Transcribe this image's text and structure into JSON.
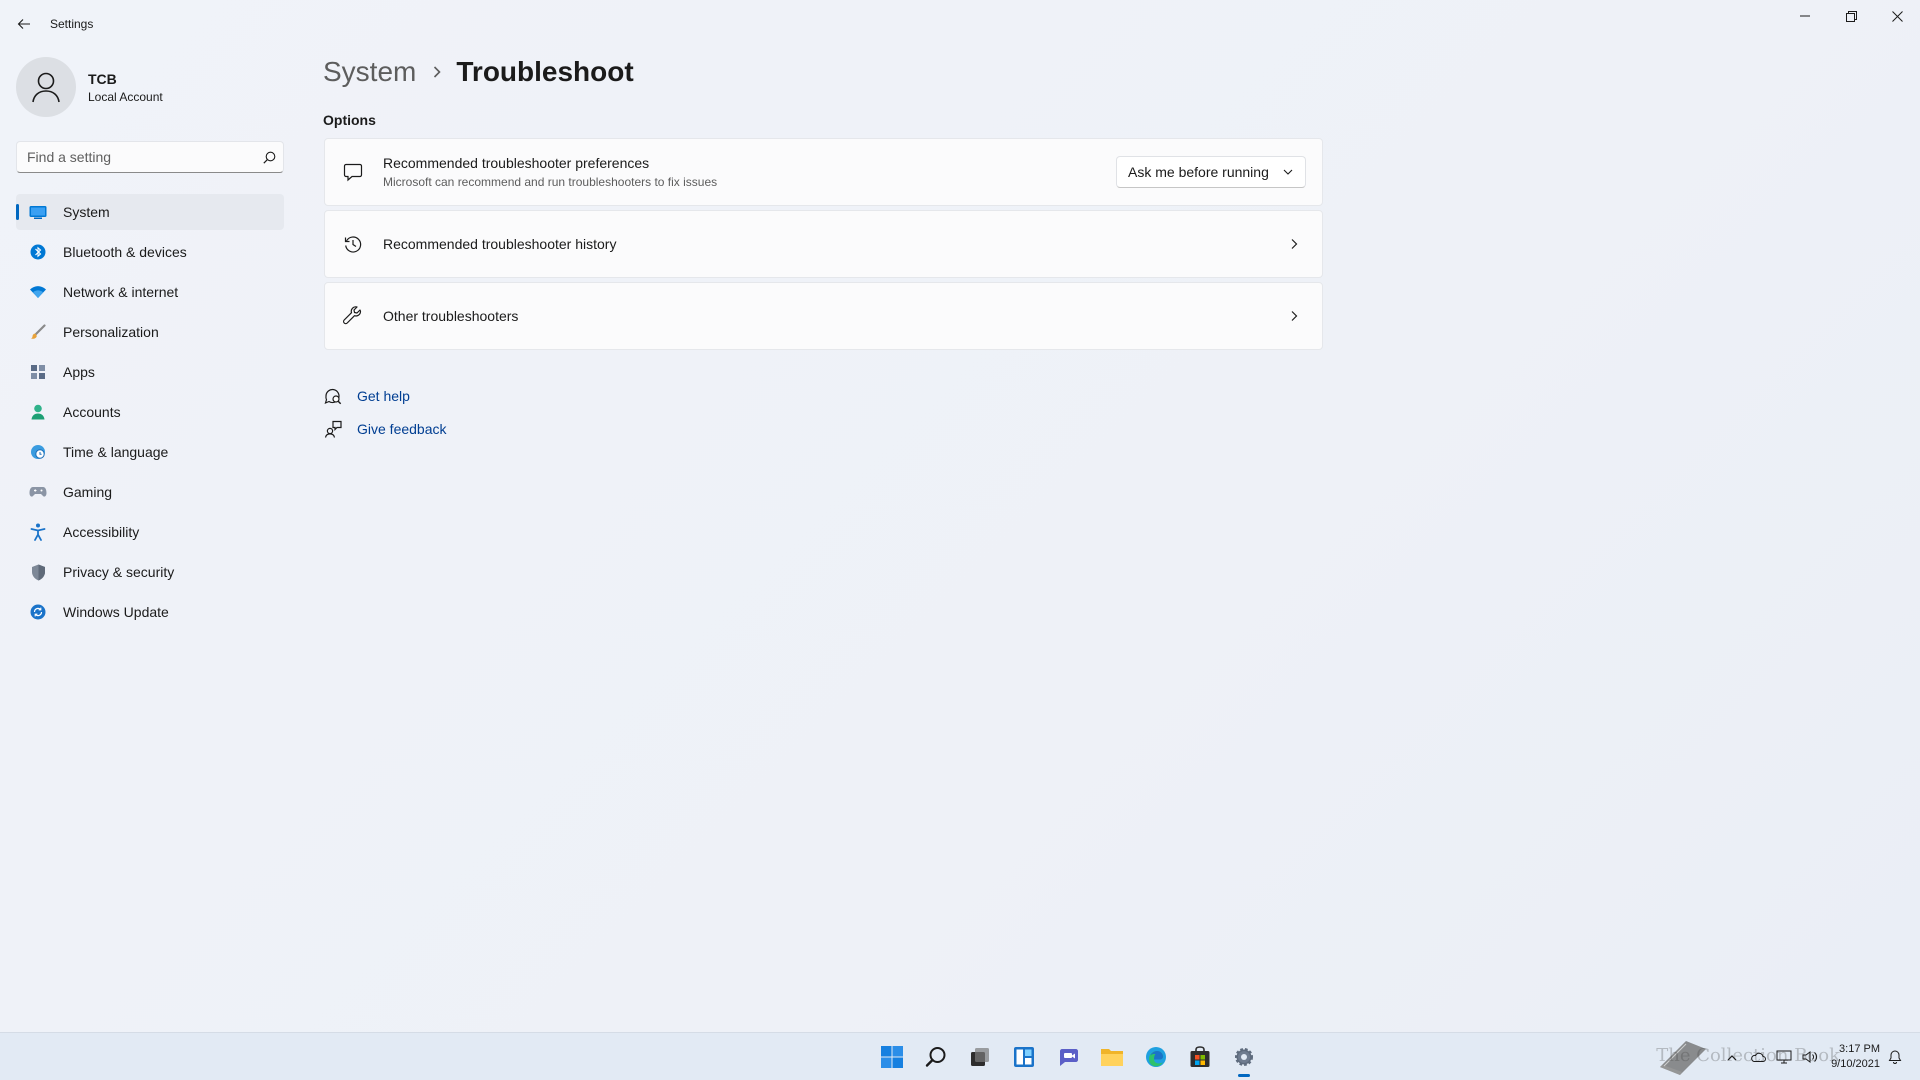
{
  "window": {
    "title": "Settings",
    "controls": [
      "minimize",
      "restore",
      "close"
    ]
  },
  "profile": {
    "name": "TCB",
    "account_type": "Local Account"
  },
  "search": {
    "placeholder": "Find a setting",
    "value": ""
  },
  "sidebar": {
    "items": [
      {
        "label": "System",
        "icon": "system-monitor-icon",
        "active": true
      },
      {
        "label": "Bluetooth & devices",
        "icon": "bluetooth-icon"
      },
      {
        "label": "Network & internet",
        "icon": "wifi-icon"
      },
      {
        "label": "Personalization",
        "icon": "brush-icon"
      },
      {
        "label": "Apps",
        "icon": "apps-icon"
      },
      {
        "label": "Accounts",
        "icon": "person-icon"
      },
      {
        "label": "Time & language",
        "icon": "globe-clock-icon"
      },
      {
        "label": "Gaming",
        "icon": "gamepad-icon"
      },
      {
        "label": "Accessibility",
        "icon": "accessibility-icon"
      },
      {
        "label": "Privacy & security",
        "icon": "shield-icon"
      },
      {
        "label": "Windows Update",
        "icon": "update-icon"
      }
    ]
  },
  "breadcrumb": {
    "parent": "System",
    "current": "Troubleshoot"
  },
  "main": {
    "section_title": "Options",
    "cards": [
      {
        "title": "Recommended troubleshooter preferences",
        "subtitle": "Microsoft can recommend and run troubleshooters to fix issues",
        "icon": "chat-bubble-icon",
        "dropdown_value": "Ask me before running"
      },
      {
        "title": "Recommended troubleshooter history",
        "icon": "history-icon"
      },
      {
        "title": "Other troubleshooters",
        "icon": "wrench-icon"
      }
    ],
    "links": [
      {
        "label": "Get help",
        "icon": "help-icon"
      },
      {
        "label": "Give feedback",
        "icon": "feedback-icon"
      }
    ]
  },
  "taskbar": {
    "icons": [
      "start-icon",
      "search-icon",
      "task-view-icon",
      "widgets-icon",
      "chat-icon",
      "file-explorer-icon",
      "edge-icon",
      "store-icon",
      "settings-icon"
    ],
    "active": "settings-icon",
    "clock_time": "3:17 PM",
    "clock_date": "9/10/2021",
    "watermark": "The Collection Book"
  },
  "colors": {
    "accent": "#0067c0",
    "link": "#003e92",
    "background": "#eef2f8"
  }
}
